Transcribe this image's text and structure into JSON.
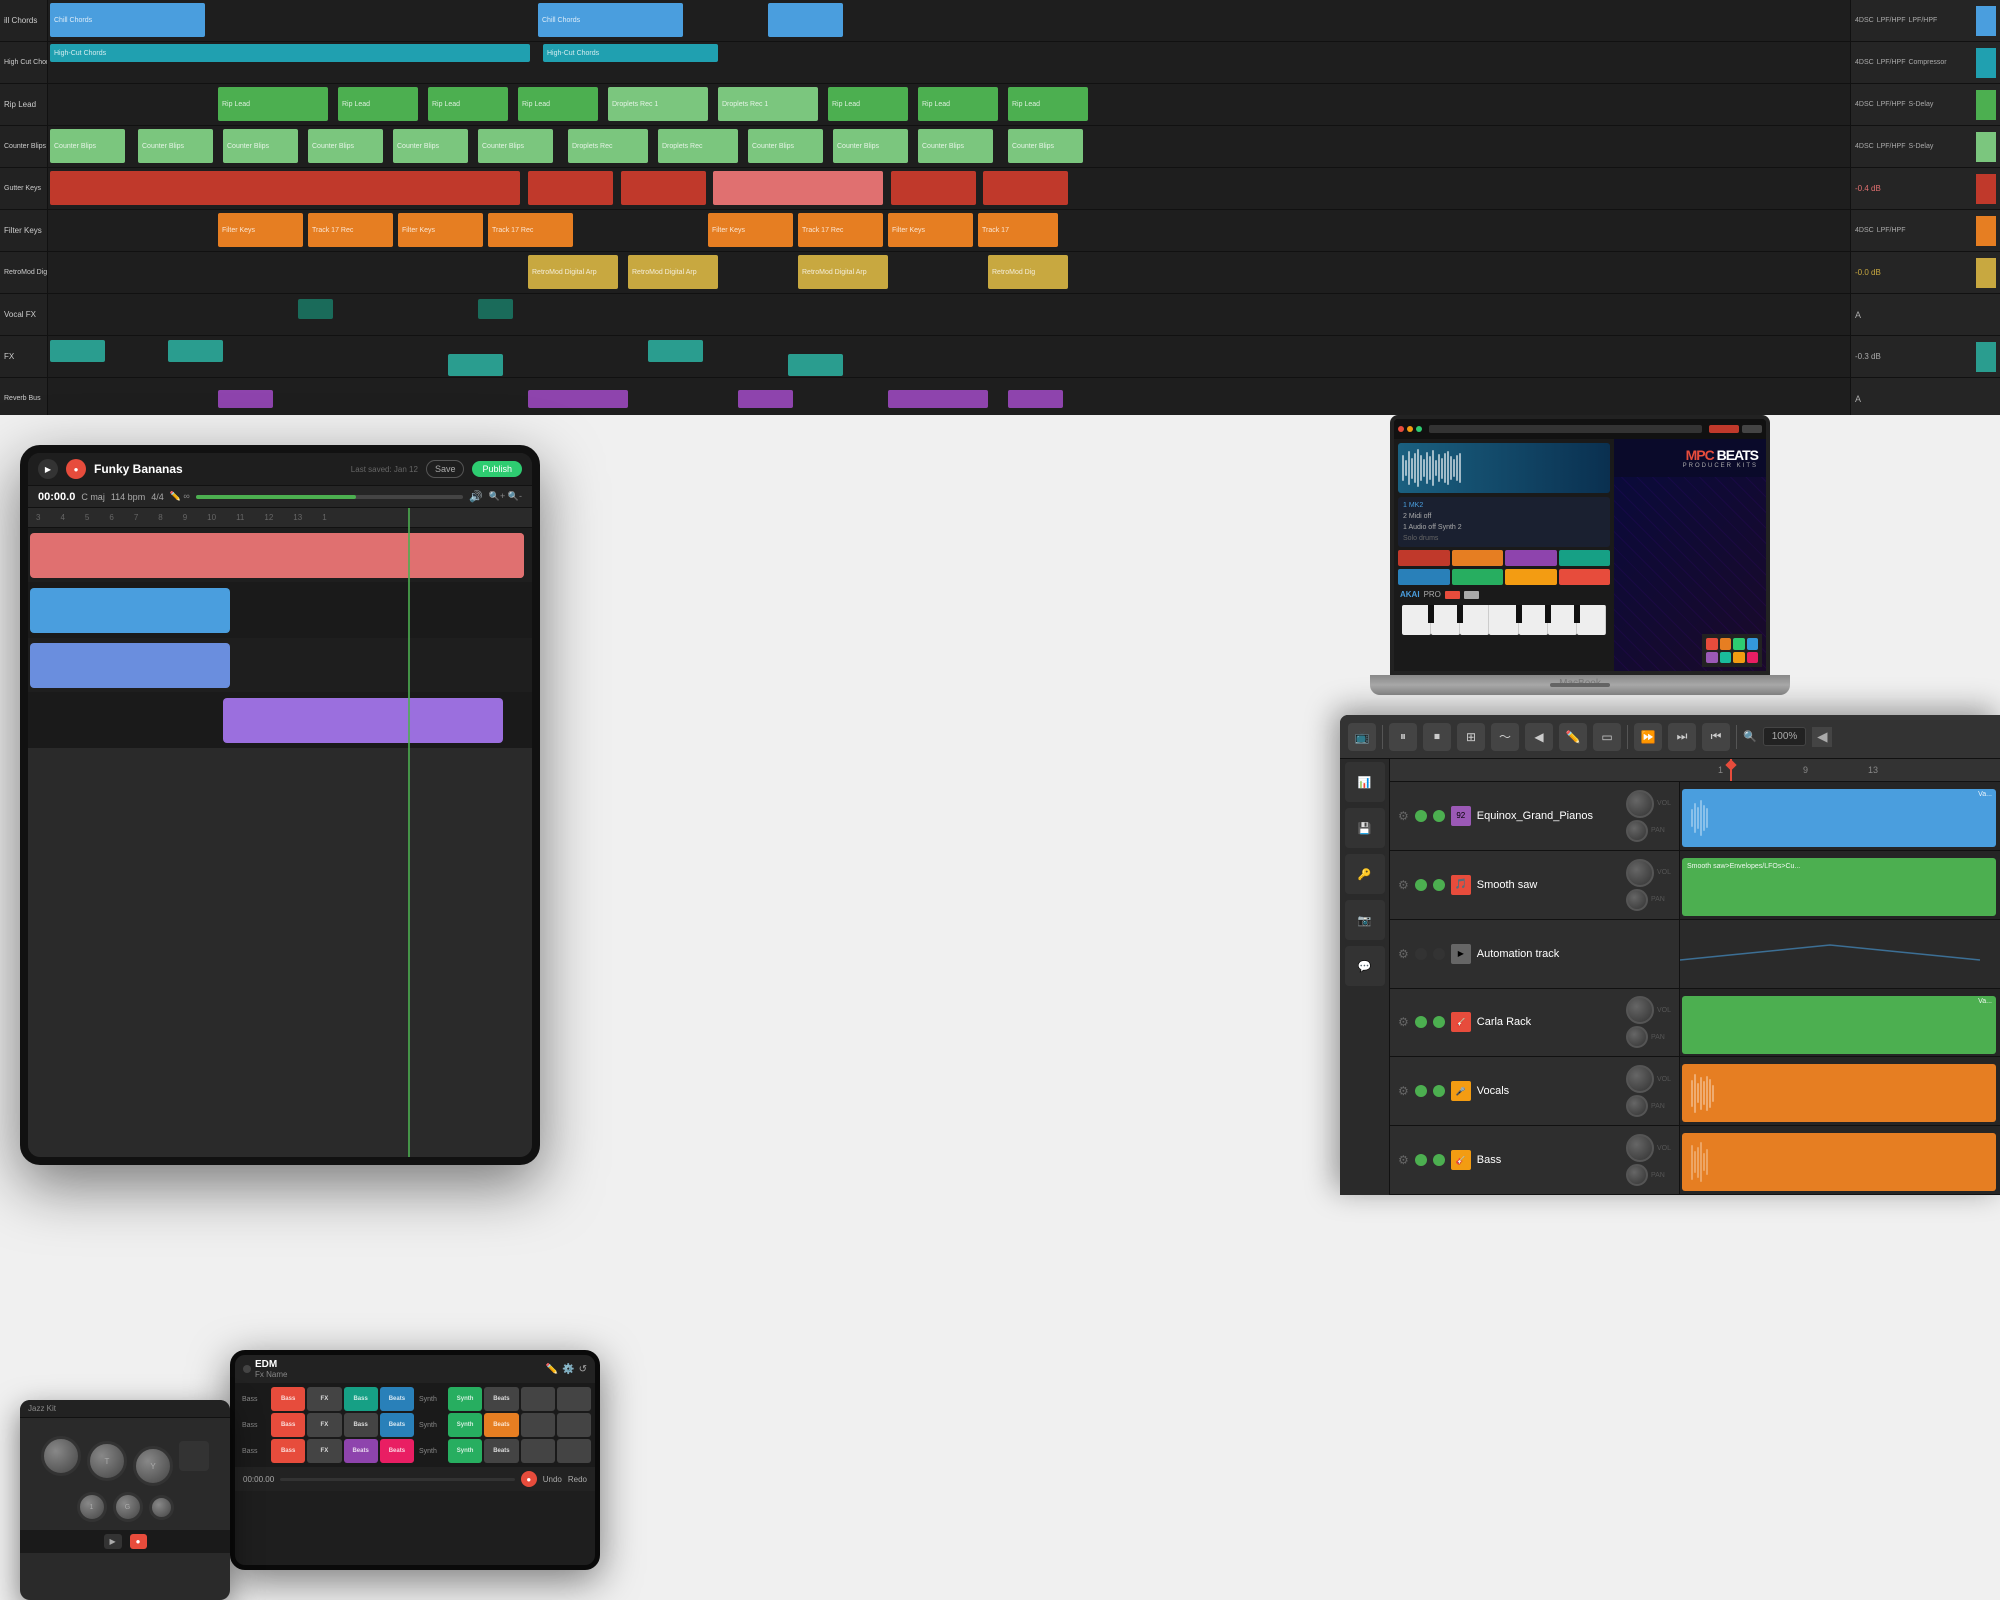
{
  "top_daw": {
    "tracks": [
      {
        "label": "ill Chords",
        "color": "c-blue",
        "controls": "4DSC  LPF/HPF  LPF/HPF"
      },
      {
        "label": "High Cut Chords",
        "color": "c-cyan",
        "controls": "4DSC  LPF/HPF  Compressor"
      },
      {
        "label": "Rip Lead",
        "color": "c-green",
        "controls": "4DSC  LPF/HPF  S-Delay"
      },
      {
        "label": "Counter Blips",
        "color": "c-lime",
        "controls": "4DSC  LPF/HPF  S-Delay"
      },
      {
        "label": "Gutter Keys",
        "color": "c-red",
        "controls": "-0.4 dB"
      },
      {
        "label": "Filter Keys",
        "color": "c-orange",
        "controls": "4DSC  LPF/HPF"
      },
      {
        "label": "RetroMod Digital",
        "color": "c-yellow",
        "controls": "-0.0 dB"
      },
      {
        "label": "Vocal FX",
        "color": "c-dark-teal",
        "controls": "A"
      },
      {
        "label": "FX",
        "color": "c-teal",
        "controls": "-0.3 dB"
      },
      {
        "label": "Reverb Bus",
        "color": "c-purple",
        "controls": "A"
      }
    ]
  },
  "tablet": {
    "title": "Funky Bananas",
    "last_saved": "Last saved: Jan 12",
    "save_label": "Save",
    "publish_label": "Publish",
    "time": "00:00.0",
    "key": "C maj",
    "bpm": "114 bpm",
    "time_sig": "4/4",
    "timeline_marks": [
      "3",
      "4",
      "5",
      "6",
      "7",
      "8",
      "9",
      "10",
      "11",
      "12",
      "13",
      "1"
    ]
  },
  "laptop": {
    "brand": "MacBook",
    "app": "MPC BEATS",
    "app_sub": "PRODUCER KITS"
  },
  "phone": {
    "title": "EDM",
    "subtitle": "Fx Name",
    "pads": [
      "Bass",
      "FX",
      "Bass",
      "Beats",
      "Synth",
      "Beats",
      "Bass",
      "FX",
      "Bass",
      "Beats",
      "Synth",
      "Beats",
      "Bass",
      "FX",
      "Beats",
      "Synth",
      "Beats"
    ]
  },
  "daw_right": {
    "zoom": "100%",
    "tracks": [
      {
        "name": "Equinox_Grand_Pianos",
        "icon": "🎹",
        "icon_color": "#9b59b6",
        "led": "green"
      },
      {
        "name": "Smooth saw",
        "icon": "🎵",
        "icon_color": "#e74c3c",
        "led": "green"
      },
      {
        "name": "Automation track",
        "icon": "📈",
        "icon_color": "#888",
        "led": "off"
      },
      {
        "name": "Carla Rack",
        "icon": "🎸",
        "icon_color": "#e74c3c",
        "led": "green"
      },
      {
        "name": "Vocals",
        "icon": "🎤",
        "icon_color": "#f39c12",
        "led": "green"
      },
      {
        "name": "Bass",
        "icon": "🎸",
        "icon_color": "#f39c12",
        "led": "green"
      }
    ],
    "ruler": [
      "1",
      "9",
      "13"
    ],
    "clips": [
      {
        "track": 0,
        "label": "Va...",
        "color": "#4a9ede",
        "left": "0%",
        "width": "90%"
      },
      {
        "track": 1,
        "label": "Smooth saw>Envelopes/LFOs>Cu...",
        "color": "#4caf50",
        "left": "0%",
        "width": "90%"
      },
      {
        "track": 2,
        "label": "",
        "color": "#555",
        "left": "0%",
        "width": "0%"
      },
      {
        "track": 3,
        "label": "Va...",
        "color": "#4caf50",
        "left": "0%",
        "width": "90%"
      },
      {
        "track": 4,
        "label": "",
        "color": "#e67e22",
        "left": "0%",
        "width": "90%"
      },
      {
        "track": 5,
        "label": "",
        "color": "#e67e22",
        "left": "0%",
        "width": "90%"
      }
    ]
  }
}
